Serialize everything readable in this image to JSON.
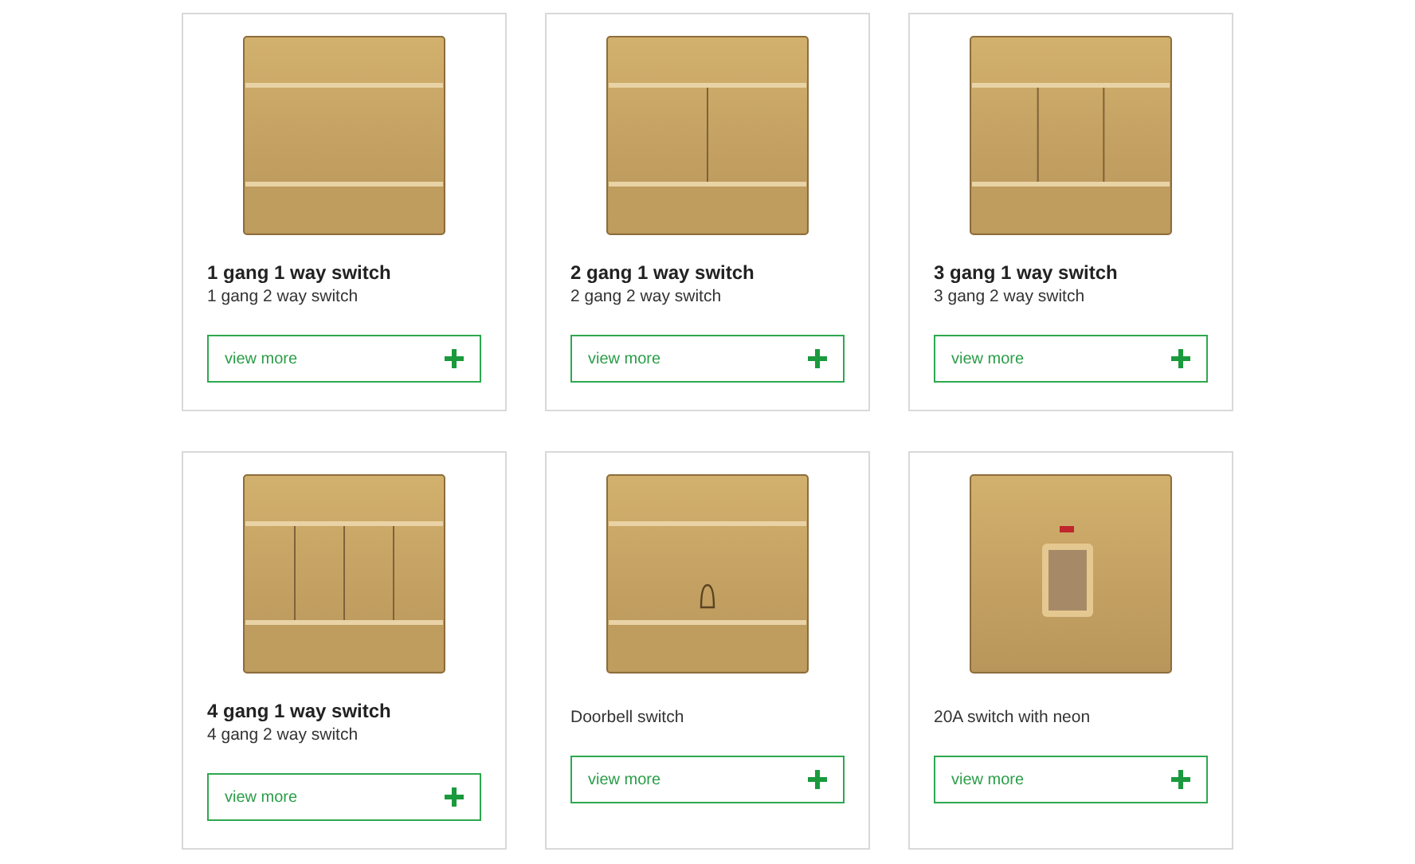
{
  "products": [
    {
      "kind": "picture",
      "title": "1 gang 1 way switch",
      "caption": "1 gang 2 way switch",
      "button": "view more"
    },
    {
      "kind": "picture",
      "title": "2 gang 1 way switch",
      "caption": "2 gang 2 way switch",
      "button": "view more"
    },
    {
      "kind": "picture",
      "title": "3 gang 1 way switch",
      "caption": "3 gang 2 way switch",
      "button": "view more"
    },
    {
      "kind": "picture",
      "title": "4 gang 1 way switch",
      "caption": "4 gang 2 way switch",
      "button": "view more"
    },
    {
      "kind": "picture",
      "caption": "Doorbell switch",
      "button": "view more"
    },
    {
      "kind": "picture",
      "caption": "20A switch with neon",
      "button": "view more"
    }
  ]
}
